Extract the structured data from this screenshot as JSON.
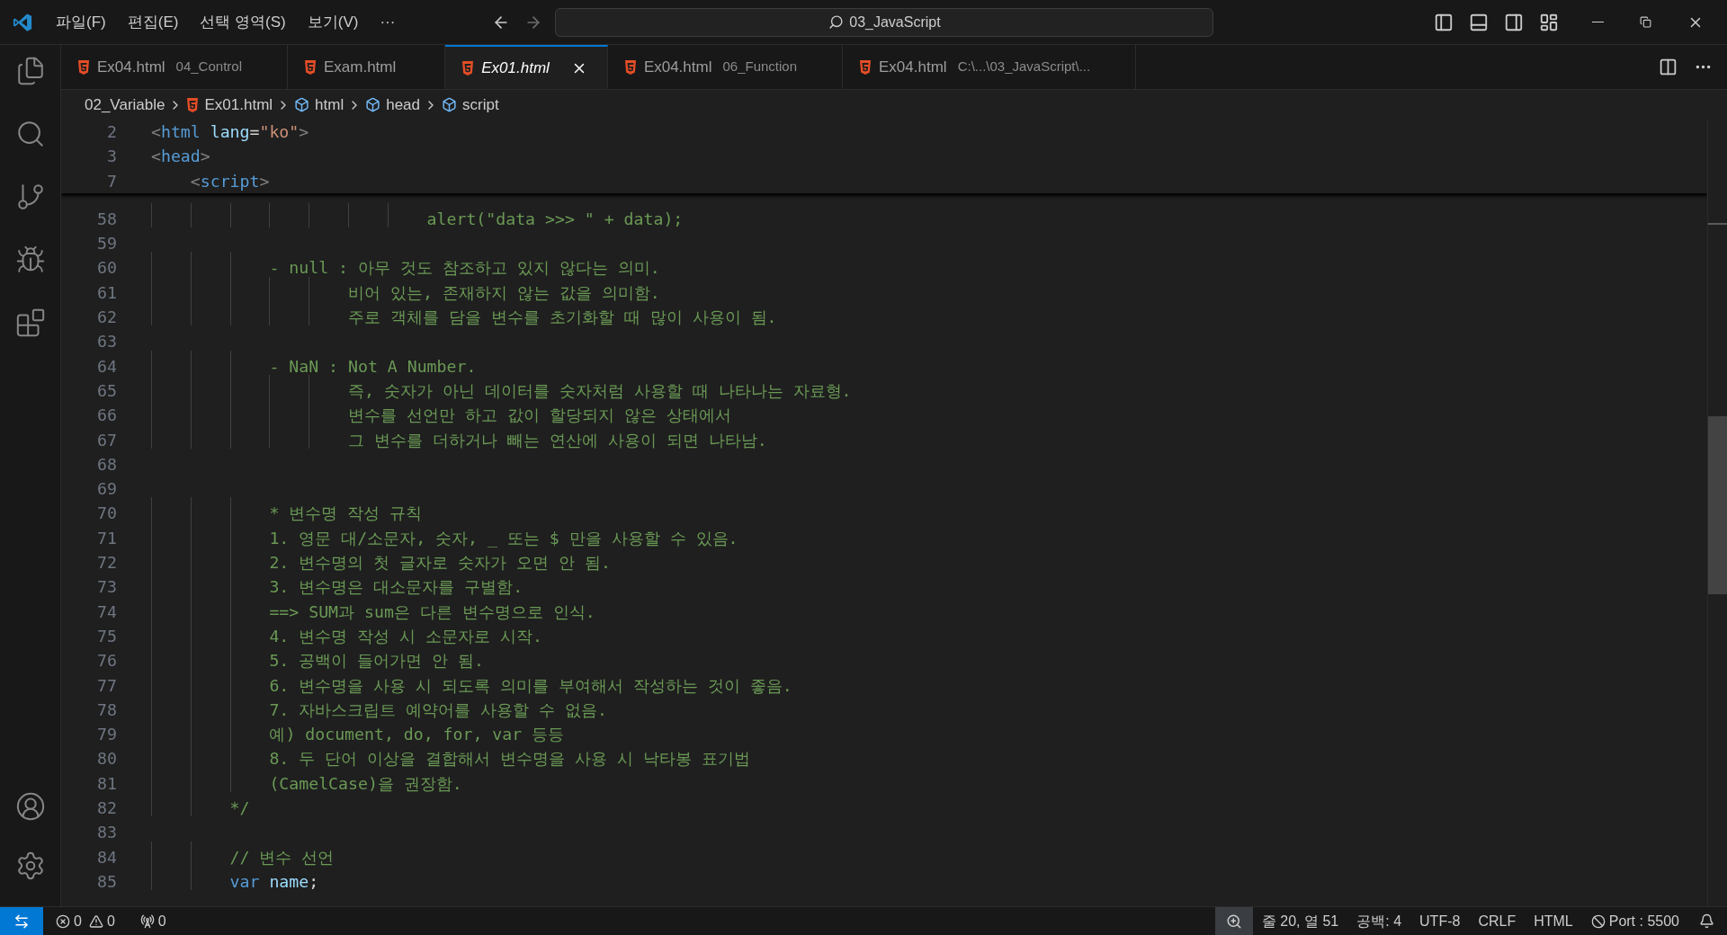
{
  "title_bar": {
    "menu": [
      "파일(F)",
      "편집(E)",
      "선택 영역(S)",
      "보기(V)",
      "···"
    ],
    "search": "03_JavaScript"
  },
  "tabs": [
    {
      "name": "Ex04.html",
      "description": "04_Control",
      "selected": false,
      "preview": false
    },
    {
      "name": "Exam.html",
      "selected": false,
      "preview": false
    },
    {
      "name": "Ex01.html",
      "selected": true,
      "preview": true
    },
    {
      "name": "Ex04.html",
      "description": "06_Function",
      "selected": false,
      "preview": false
    },
    {
      "name": "Ex04.html",
      "description": "C:\\...\\03_JavaScript\\...",
      "selected": false,
      "preview": false
    }
  ],
  "breadcrumb": [
    {
      "label": "02_Variable",
      "kind": "folder"
    },
    {
      "label": "Ex01.html",
      "kind": "file"
    },
    {
      "label": "html",
      "kind": "symbol"
    },
    {
      "label": "head",
      "kind": "symbol"
    },
    {
      "label": "script",
      "kind": "symbol"
    }
  ],
  "sticky_lines": [
    {
      "number": "2",
      "tokens": [
        {
          "text": "<",
          "kind": "bracket"
        },
        {
          "text": "html",
          "kind": "tag"
        },
        {
          "text": " lang",
          "kind": "attr"
        },
        {
          "text": "=",
          "kind": "plain"
        },
        {
          "text": "\"ko\"",
          "kind": "string"
        },
        {
          "text": ">",
          "kind": "bracket"
        }
      ]
    },
    {
      "number": "3",
      "tokens": [
        {
          "text": "<",
          "kind": "bracket"
        },
        {
          "text": "head",
          "kind": "tag"
        },
        {
          "text": ">",
          "kind": "bracket"
        }
      ]
    },
    {
      "number": "7",
      "tokens": [
        {
          "text": "    <",
          "kind": "bracket"
        },
        {
          "text": "script",
          "kind": "tag"
        },
        {
          "text": ">",
          "kind": "bracket"
        }
      ]
    }
  ],
  "lines": [
    {
      "number": "58",
      "tokens": [
        {
          "text": "                            alert(\"data >>> \" + data);",
          "kind": "comment"
        }
      ]
    },
    {
      "number": "59"
    },
    {
      "number": "60",
      "tokens": [
        {
          "text": "            - null : 아무 것도 참조하고 있지 않다는 의미.",
          "kind": "comment"
        }
      ]
    },
    {
      "number": "61",
      "tokens": [
        {
          "text": "                    비어 있는, 존재하지 않는 값을 의미함.",
          "kind": "comment"
        }
      ]
    },
    {
      "number": "62",
      "tokens": [
        {
          "text": "                    주로 객체를 담을 변수를 초기화할 때 많이 사용이 됨.",
          "kind": "comment"
        }
      ]
    },
    {
      "number": "63"
    },
    {
      "number": "64",
      "tokens": [
        {
          "text": "            - NaN : Not A Number.",
          "kind": "comment"
        }
      ]
    },
    {
      "number": "65",
      "tokens": [
        {
          "text": "                    즉, 숫자가 아닌 데이터를 숫자처럼 사용할 때 나타나는 자료형.",
          "kind": "comment"
        }
      ]
    },
    {
      "number": "66",
      "tokens": [
        {
          "text": "                    변수를 선언만 하고 값이 할당되지 않은 상태에서",
          "kind": "comment"
        }
      ]
    },
    {
      "number": "67",
      "tokens": [
        {
          "text": "                    그 변수를 더하거나 빼는 연산에 사용이 되면 나타남.",
          "kind": "comment"
        }
      ]
    },
    {
      "number": "68"
    },
    {
      "number": "69"
    },
    {
      "number": "70",
      "tokens": [
        {
          "text": "            * 변수명 작성 규칙",
          "kind": "comment"
        }
      ]
    },
    {
      "number": "71",
      "tokens": [
        {
          "text": "            1. 영문 대/소문자, 숫자, _ 또는 $ 만을 사용할 수 있음.",
          "kind": "comment"
        }
      ]
    },
    {
      "number": "72",
      "tokens": [
        {
          "text": "            2. 변수명의 첫 글자로 숫자가 오면 안 됨.",
          "kind": "comment"
        }
      ]
    },
    {
      "number": "73",
      "tokens": [
        {
          "text": "            3. 변수명은 대소문자를 구별함.",
          "kind": "comment"
        }
      ]
    },
    {
      "number": "74",
      "tokens": [
        {
          "text": "            ==> SUM과 sum은 다른 변수명으로 인식.",
          "kind": "comment"
        }
      ]
    },
    {
      "number": "75",
      "tokens": [
        {
          "text": "            4. 변수명 작성 시 소문자로 시작.",
          "kind": "comment"
        }
      ]
    },
    {
      "number": "76",
      "tokens": [
        {
          "text": "            5. 공백이 들어가면 안 됨.",
          "kind": "comment"
        }
      ]
    },
    {
      "number": "77",
      "tokens": [
        {
          "text": "            6. 변수명을 사용 시 되도록 의미를 부여해서 작성하는 것이 좋음.",
          "kind": "comment"
        }
      ]
    },
    {
      "number": "78",
      "tokens": [
        {
          "text": "            7. 자바스크립트 예약어를 사용할 수 없음.",
          "kind": "comment"
        }
      ]
    },
    {
      "number": "79",
      "tokens": [
        {
          "text": "            예) document, do, for, var 등등",
          "kind": "comment"
        }
      ]
    },
    {
      "number": "80",
      "tokens": [
        {
          "text": "            8. 두 단어 이상을 결합해서 변수명을 사용 시 낙타봉 표기법",
          "kind": "comment"
        }
      ]
    },
    {
      "number": "81",
      "tokens": [
        {
          "text": "            (CamelCase)을 권장함.",
          "kind": "comment"
        }
      ]
    },
    {
      "number": "82",
      "tokens": [
        {
          "text": "        */",
          "kind": "comment"
        }
      ]
    },
    {
      "number": "83"
    },
    {
      "number": "84",
      "tokens": [
        {
          "text": "        // 변수 선언",
          "kind": "comment"
        }
      ]
    },
    {
      "number": "85",
      "tokens": [
        {
          "text": "        var",
          "kind": "keyword"
        },
        {
          "text": " name",
          "kind": "variable"
        },
        {
          "text": ";",
          "kind": "plain"
        }
      ]
    }
  ],
  "status_bar": {
    "errors": "0",
    "warnings": "0",
    "ports": "0",
    "items": [
      {
        "kind": "zoom"
      },
      {
        "kind": "text",
        "text": "줄 20, 열 51"
      },
      {
        "kind": "text",
        "text": "공백: 4"
      },
      {
        "kind": "text",
        "text": "UTF-8"
      },
      {
        "kind": "text",
        "text": "CRLF"
      },
      {
        "kind": "text",
        "text": "HTML"
      },
      {
        "kind": "port",
        "text": "Port : 5500"
      },
      {
        "kind": "bell"
      }
    ]
  }
}
